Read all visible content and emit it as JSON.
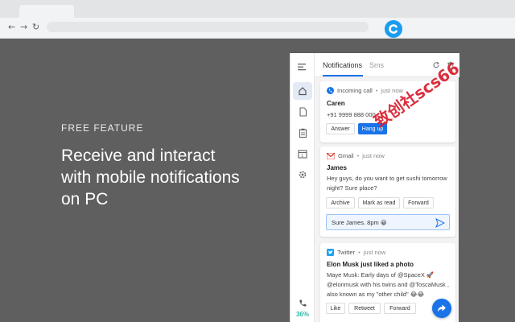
{
  "browser": {
    "nav_back": "←",
    "nav_forward": "→",
    "nav_reload": "↻",
    "extension_icon": "c-logo-icon"
  },
  "promo": {
    "kicker": "FREE FEATURE",
    "headline": "Receive and interact with mobile notifications on PC"
  },
  "panel": {
    "tabs": [
      {
        "label": "Notifications",
        "active": true
      },
      {
        "label": "Sms",
        "active": false
      }
    ],
    "battery_percent": "36%",
    "accent_color": "#1a73e8",
    "cards": [
      {
        "app": "Incoming call",
        "time": "just now",
        "sender": "Caren",
        "body": "+91 9999 888 000",
        "buttons": [
          "Answer",
          "Hang up"
        ]
      },
      {
        "app": "Gmail",
        "time": "just now",
        "sender": "James",
        "body": "Hey guys, do you want to get sushi tomorrow night? Sure place?",
        "buttons": [
          "Archive",
          "Mark as read",
          "Forward"
        ],
        "reply": "Sure James. 8pm 😀"
      },
      {
        "app": "Twitter",
        "time": "just now",
        "sender": "Elon Musk just liked a photo",
        "body": "Maye Musk: Early days of @SpaceX 🚀 @elonmusk with his twins and @ToscaMusk , also known as my \"other child\" 😂😂",
        "buttons": [
          "Like",
          "Retweet",
          "Forward"
        ]
      }
    ]
  },
  "watermark": "致创社scs66"
}
